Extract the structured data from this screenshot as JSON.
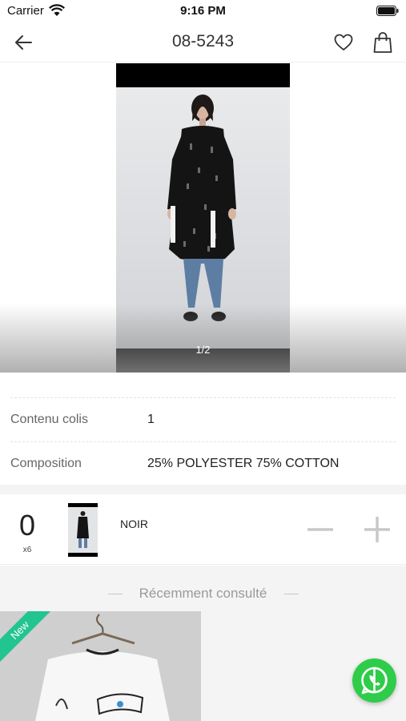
{
  "status_bar": {
    "carrier": "Carrier",
    "time": "9:16 PM"
  },
  "nav": {
    "title": "08-5243"
  },
  "gallery": {
    "counter": "1/2"
  },
  "details": [
    {
      "label": "Contenu colis",
      "value": "1"
    },
    {
      "label": "Composition",
      "value": "25% POLYESTER 75% COTTON"
    }
  ],
  "variant": {
    "quantity": "0",
    "multiplier": "x6",
    "color": "NOIR"
  },
  "recent": {
    "heading": "Récemment consulté",
    "badge": "New"
  },
  "colors": {
    "accent_green": "#22c48f",
    "whatsapp_green": "#2fcc4a",
    "section_bg": "#f4f4f4"
  },
  "icons": [
    "wifi-icon",
    "battery-icon",
    "back-arrow-icon",
    "heart-icon",
    "shopping-bag-icon",
    "minus-icon",
    "plus-icon",
    "whatsapp-icon"
  ]
}
